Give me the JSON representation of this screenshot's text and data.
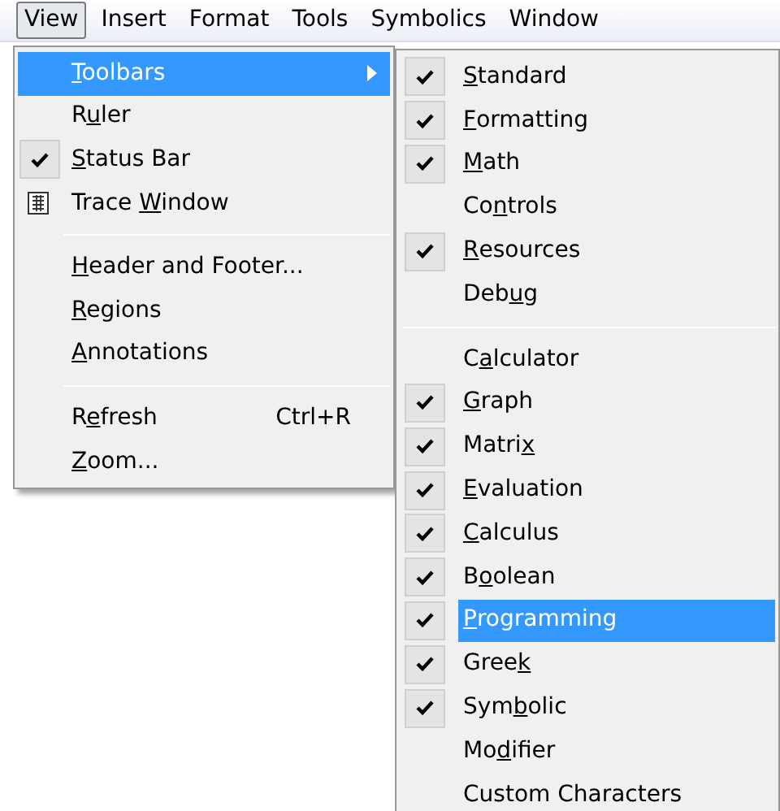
{
  "menu_bar": [
    {
      "label": "View",
      "selected": true
    },
    {
      "label": "Insert",
      "selected": false
    },
    {
      "label": "Format",
      "selected": false
    },
    {
      "label": "Tools",
      "selected": false
    },
    {
      "label": "Symbolics",
      "selected": false
    },
    {
      "label": "Window",
      "selected": false
    }
  ],
  "view_menu": [
    {
      "kind": "item",
      "key": "T",
      "post": "oolbars",
      "submenu": true,
      "selected": true,
      "checked": false
    },
    {
      "kind": "item",
      "pre": "R",
      "key": "u",
      "post": "ler",
      "submenu": false,
      "selected": false,
      "checked": false
    },
    {
      "kind": "item",
      "key": "S",
      "post": "tatus Bar",
      "submenu": false,
      "selected": false,
      "checked": true
    },
    {
      "kind": "icon_item",
      "pre": "Trace ",
      "key": "W",
      "post": "indow",
      "submenu": false,
      "selected": false
    },
    {
      "kind": "separator"
    },
    {
      "kind": "item",
      "key": "H",
      "post": "eader and Footer...",
      "submenu": false,
      "selected": false,
      "checked": false
    },
    {
      "kind": "item",
      "key": "R",
      "post": "egions",
      "submenu": false,
      "selected": false,
      "checked": false
    },
    {
      "kind": "item",
      "key": "A",
      "post": "nnotations",
      "submenu": false,
      "selected": false,
      "checked": false
    },
    {
      "kind": "separator"
    },
    {
      "kind": "item",
      "pre": "R",
      "key": "e",
      "post": "fresh",
      "shortcut": "Ctrl+R",
      "submenu": false,
      "selected": false,
      "checked": false
    },
    {
      "kind": "item",
      "key": "Z",
      "post": "oom...",
      "submenu": false,
      "selected": false,
      "checked": false
    }
  ],
  "toolbars_submenu": [
    {
      "kind": "item",
      "key": "S",
      "post": "tandard",
      "selected": false,
      "checked": true
    },
    {
      "kind": "item",
      "key": "F",
      "post": "ormatting",
      "selected": false,
      "checked": true
    },
    {
      "kind": "item",
      "key": "M",
      "post": "ath",
      "selected": false,
      "checked": true
    },
    {
      "kind": "item",
      "pre": "Co",
      "key": "n",
      "post": "trols",
      "selected": false,
      "checked": false
    },
    {
      "kind": "item",
      "key": "R",
      "post": "esources",
      "selected": false,
      "checked": true
    },
    {
      "kind": "item",
      "pre": "Deb",
      "key": "u",
      "post": "g",
      "selected": false,
      "checked": false
    },
    {
      "kind": "separator"
    },
    {
      "kind": "item",
      "pre": "C",
      "key": "a",
      "post": "lculator",
      "selected": false,
      "checked": false
    },
    {
      "kind": "item",
      "key": "G",
      "post": "raph",
      "selected": false,
      "checked": true
    },
    {
      "kind": "item",
      "pre": "Matri",
      "key": "x",
      "selected": false,
      "checked": true
    },
    {
      "kind": "item",
      "key": "E",
      "post": "valuation",
      "selected": false,
      "checked": true
    },
    {
      "kind": "item",
      "key": "C",
      "post": "alculus",
      "selected": false,
      "checked": true
    },
    {
      "kind": "item",
      "pre": "B",
      "key": "o",
      "post": "olean",
      "selected": false,
      "checked": true
    },
    {
      "kind": "item",
      "key": "P",
      "post": "rogramming",
      "selected": true,
      "checked": true
    },
    {
      "kind": "item",
      "pre": "Gree",
      "key": "k",
      "selected": false,
      "checked": true
    },
    {
      "kind": "item",
      "pre": "Sym",
      "key": "b",
      "post": "olic",
      "selected": false,
      "checked": true
    },
    {
      "kind": "item",
      "pre": "Mo",
      "key": "d",
      "post": "ifier",
      "selected": false,
      "checked": false
    },
    {
      "kind": "item",
      "pre": "Custom Characters",
      "selected": false,
      "checked": false
    }
  ]
}
